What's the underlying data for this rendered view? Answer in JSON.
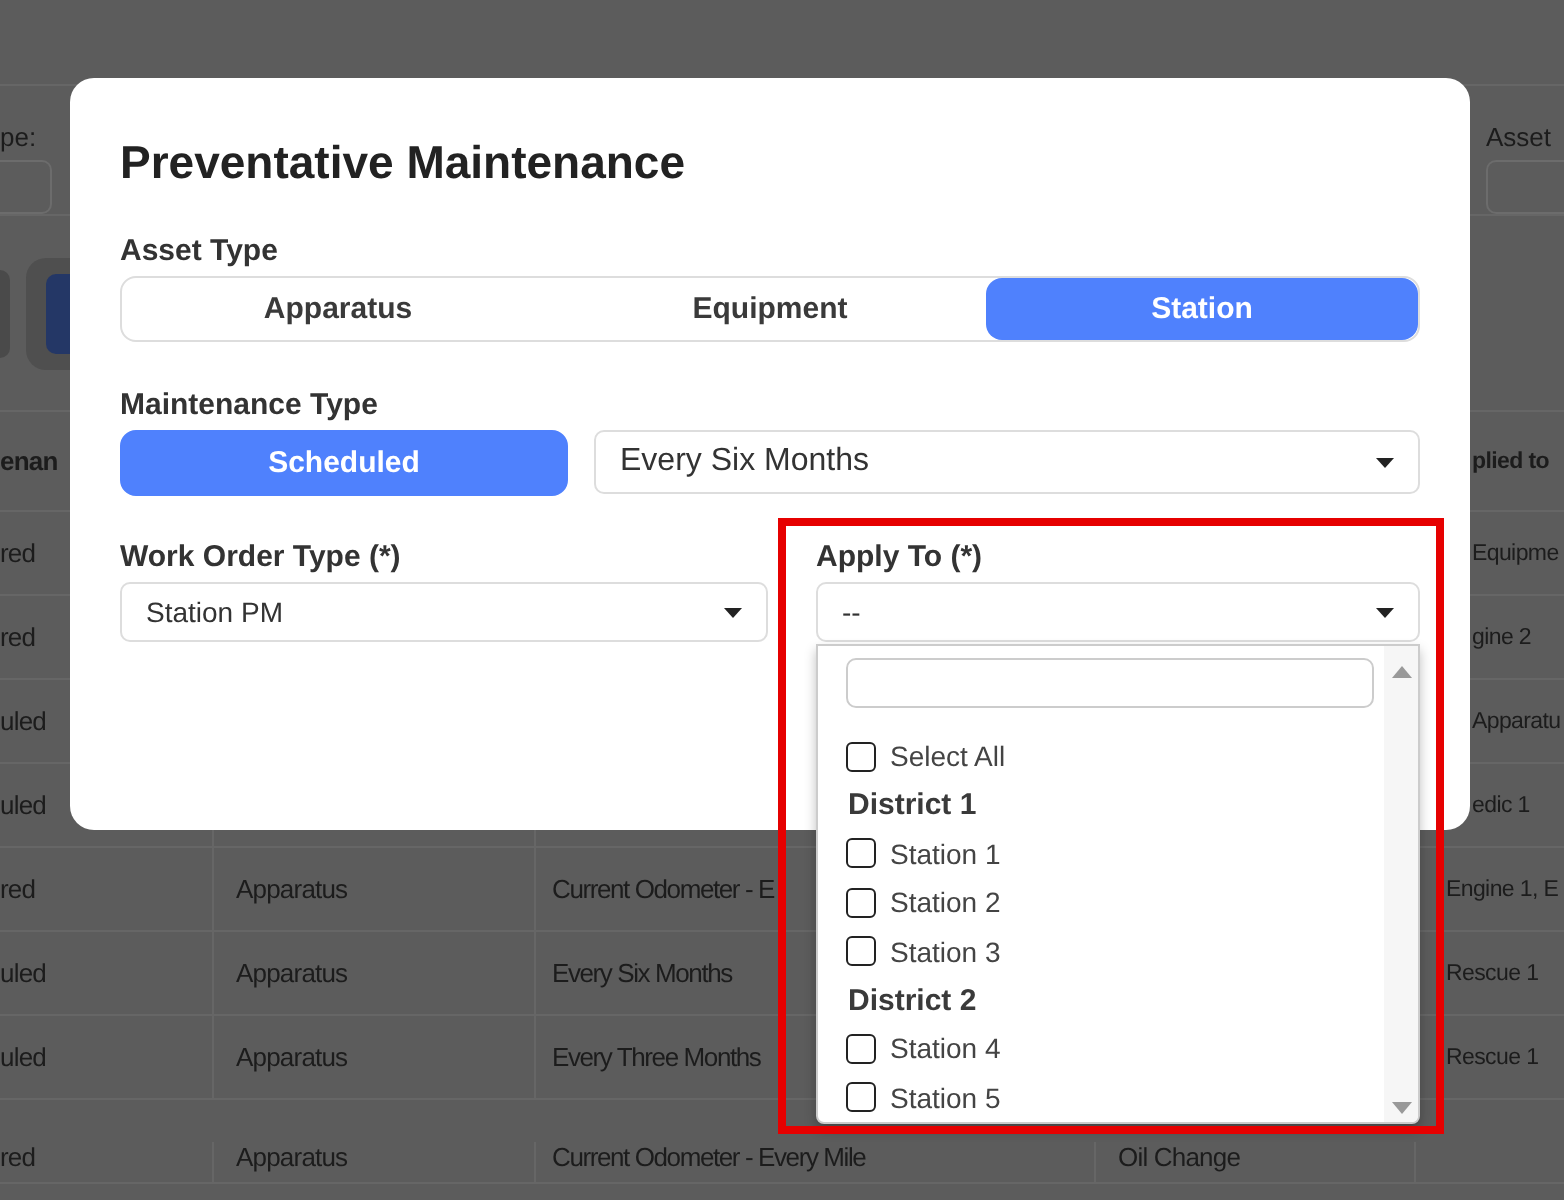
{
  "background": {
    "filters": [
      {
        "label": "pe:"
      },
      {
        "label": "Asset"
      }
    ],
    "table": {
      "header": {
        "column_1": "enan",
        "column_5": "plied to"
      },
      "rows": [
        {
          "column_1": "red",
          "column_5": "Equipme"
        },
        {
          "column_1": "red",
          "column_5": "gine 2"
        },
        {
          "column_1": "uled",
          "column_5": "Apparatu"
        },
        {
          "column_1": "uled",
          "column_5": "edic 1"
        },
        {
          "column_1": "red",
          "column_2": "Apparatus",
          "column_3": "Current Odometer - E",
          "column_5": "Engine 1, E"
        },
        {
          "column_1": "uled",
          "column_2": "Apparatus",
          "column_3": "Every Six Months",
          "column_5": "Rescue 1"
        },
        {
          "column_1": "uled",
          "column_2": "Apparatus",
          "column_3": "Every Three Months",
          "column_5": "Rescue 1"
        },
        {
          "column_1": "red",
          "column_2": "Apparatus",
          "column_3": "Current Odometer - Every Mile",
          "column_4": "Oil Change"
        }
      ]
    }
  },
  "modal": {
    "title": "Preventative Maintenance",
    "asset_type": {
      "label": "Asset Type",
      "options": [
        {
          "label": "Apparatus",
          "selected": false
        },
        {
          "label": "Equipment",
          "selected": false
        },
        {
          "label": "Station",
          "selected": true
        }
      ]
    },
    "maintenance_type": {
      "label": "Maintenance Type",
      "toggle": {
        "label": "Scheduled",
        "selected": true
      },
      "interval": {
        "value": "Every Six Months"
      }
    },
    "work_order_type": {
      "label": "Work Order Type (*)",
      "value": "Station PM"
    },
    "apply_to": {
      "label": "Apply To (*)",
      "value": "--",
      "dropdown": {
        "items": [
          {
            "kind": "option",
            "label": "Select All",
            "checked": false
          },
          {
            "kind": "group",
            "label": "District 1"
          },
          {
            "kind": "option",
            "label": "Station 1",
            "checked": false
          },
          {
            "kind": "option",
            "label": "Station 2",
            "checked": false
          },
          {
            "kind": "option",
            "label": "Station 3",
            "checked": false
          },
          {
            "kind": "group",
            "label": "District 2"
          },
          {
            "kind": "option",
            "label": "Station 4",
            "checked": false
          },
          {
            "kind": "option",
            "label": "Station 5",
            "checked": false
          }
        ]
      }
    }
  }
}
